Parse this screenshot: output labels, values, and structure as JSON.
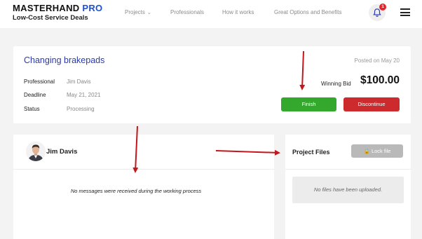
{
  "brand": {
    "name": "MASTERHAND",
    "name_accent": "PRO",
    "tagline": "Low-Cost Service Deals",
    "accent_color": "#1c4fd6"
  },
  "nav": {
    "items": [
      {
        "label": "Projects",
        "has_dropdown": true
      },
      {
        "label": "Professionals"
      },
      {
        "label": "How it works"
      },
      {
        "label": "Great Options and Benefits"
      }
    ],
    "notifications_count": "1",
    "bell_icon": "bell-icon",
    "menu_icon": "hamburger-menu-icon"
  },
  "project": {
    "title": "Changing brakepads",
    "posted": "Posted on May 20",
    "fields": [
      {
        "label": "Professional",
        "value": "Jim Davis"
      },
      {
        "label": "Deadline",
        "value": "May 21, 2021"
      },
      {
        "label": "Status",
        "value": "Processing"
      }
    ],
    "winning_bid_label": "Winning Bid",
    "winning_bid_value": "$100.00",
    "finish_label": "Finish",
    "discontinue_label": "Discontinue",
    "colors": {
      "finish": "#34a82c",
      "discontinue": "#cd2a2e",
      "title": "#2a3ab0"
    }
  },
  "messages": {
    "participant_name": "Jim Davis",
    "empty_text": "No messages were received during the working process"
  },
  "files": {
    "title": "Project Files",
    "lock_label": "Lock file",
    "lock_icon": "lock-icon",
    "empty_text": "No files have been uploaded."
  },
  "annotations": {
    "arrow_color": "#c0181c"
  }
}
